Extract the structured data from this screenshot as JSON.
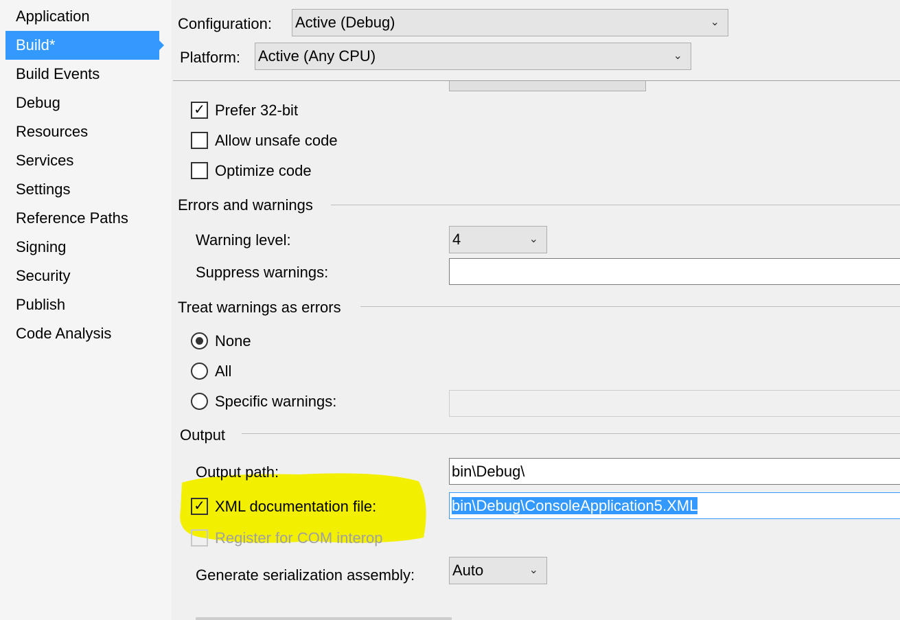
{
  "sidebar": {
    "items": [
      {
        "label": "Application"
      },
      {
        "label": "Build*",
        "selected": true
      },
      {
        "label": "Build Events"
      },
      {
        "label": "Debug"
      },
      {
        "label": "Resources"
      },
      {
        "label": "Services"
      },
      {
        "label": "Settings"
      },
      {
        "label": "Reference Paths"
      },
      {
        "label": "Signing"
      },
      {
        "label": "Security"
      },
      {
        "label": "Publish"
      },
      {
        "label": "Code Analysis"
      }
    ]
  },
  "header": {
    "configuration_label": "Configuration:",
    "configuration_value": "Active (Debug)",
    "platform_label": "Platform:",
    "platform_value": "Active (Any CPU)"
  },
  "general": {
    "prefer32": "Prefer 32-bit",
    "unsafe": "Allow unsafe code",
    "optimize": "Optimize code"
  },
  "errors": {
    "title": "Errors and warnings",
    "warning_level_label": "Warning level:",
    "warning_level_value": "4",
    "suppress_label": "Suppress warnings:",
    "suppress_value": ""
  },
  "treat": {
    "title": "Treat warnings as errors",
    "none": "None",
    "all": "All",
    "specific": "Specific warnings:"
  },
  "output": {
    "title": "Output",
    "path_label": "Output path:",
    "path_value": "bin\\Debug\\",
    "xml_label": "XML documentation file:",
    "xml_value": "bin\\Debug\\ConsoleApplication5.XML",
    "com_label": "Register for COM interop",
    "serialization_label": "Generate serialization assembly:",
    "serialization_value": "Auto"
  },
  "colors": {
    "accent": "#3399ff",
    "highlight": "#f2f000"
  }
}
